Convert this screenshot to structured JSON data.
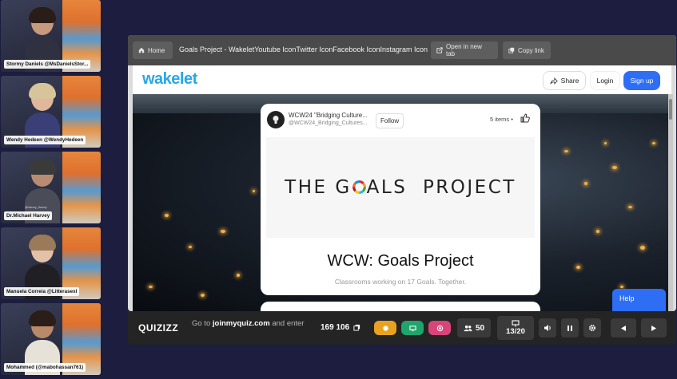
{
  "participants": [
    {
      "name": "Stormy Daniels @MsDanielsStor..."
    },
    {
      "name": "Wendy Hedeen @WendyHedeen"
    },
    {
      "name": "Dr.Michael Harvey",
      "subname": "@Harvey_Harvey"
    },
    {
      "name": "Manuela Correia @Litterasexl"
    },
    {
      "name": "Mohammed (@mabohassan761)"
    }
  ],
  "browser": {
    "home_label": "Home",
    "tab_title": "Goals Project - WakeletYoutube IconTwitter IconFacebook IconInstagram Icon",
    "open_new_tab_label": "Open in new tab",
    "copy_link_label": "Copy link"
  },
  "wakelet": {
    "logo": "wakelet",
    "share_label": "Share",
    "login_label": "Login",
    "signup_label": "Sign up",
    "help_label": "Help"
  },
  "card": {
    "title": "WCW24 \"Bridging Culture...",
    "handle": "@WCW24_Bridging_Cultures...",
    "follow_label": "Follow",
    "items_count": "5 items",
    "items_sep": "•",
    "banner_part1": "THE G",
    "banner_part2": "ALS  PROJECT",
    "heading": "WCW: Goals Project",
    "subheading": "Classrooms working on 17 Goals. Together."
  },
  "quizizz": {
    "logo": "QUIZIZZ",
    "join_prefix": "Go to",
    "join_url": "joinmyquiz.com",
    "join_suffix": "and enter",
    "code": "169 106",
    "players": "50",
    "progress": "13/20"
  },
  "colors": {
    "background": "#1c1d3f",
    "wakelet_blue": "#2aa7e8",
    "signup_blue": "#2d6ef5",
    "pill_orange": "#e8a21f",
    "pill_green": "#1fa56b",
    "pill_pink": "#d9447a"
  },
  "icons": {
    "home": "home-icon",
    "share": "share-icon",
    "thumb": "thumbs-up-icon",
    "volume": "volume-icon",
    "pause": "pause-icon",
    "settings": "gear-icon"
  }
}
